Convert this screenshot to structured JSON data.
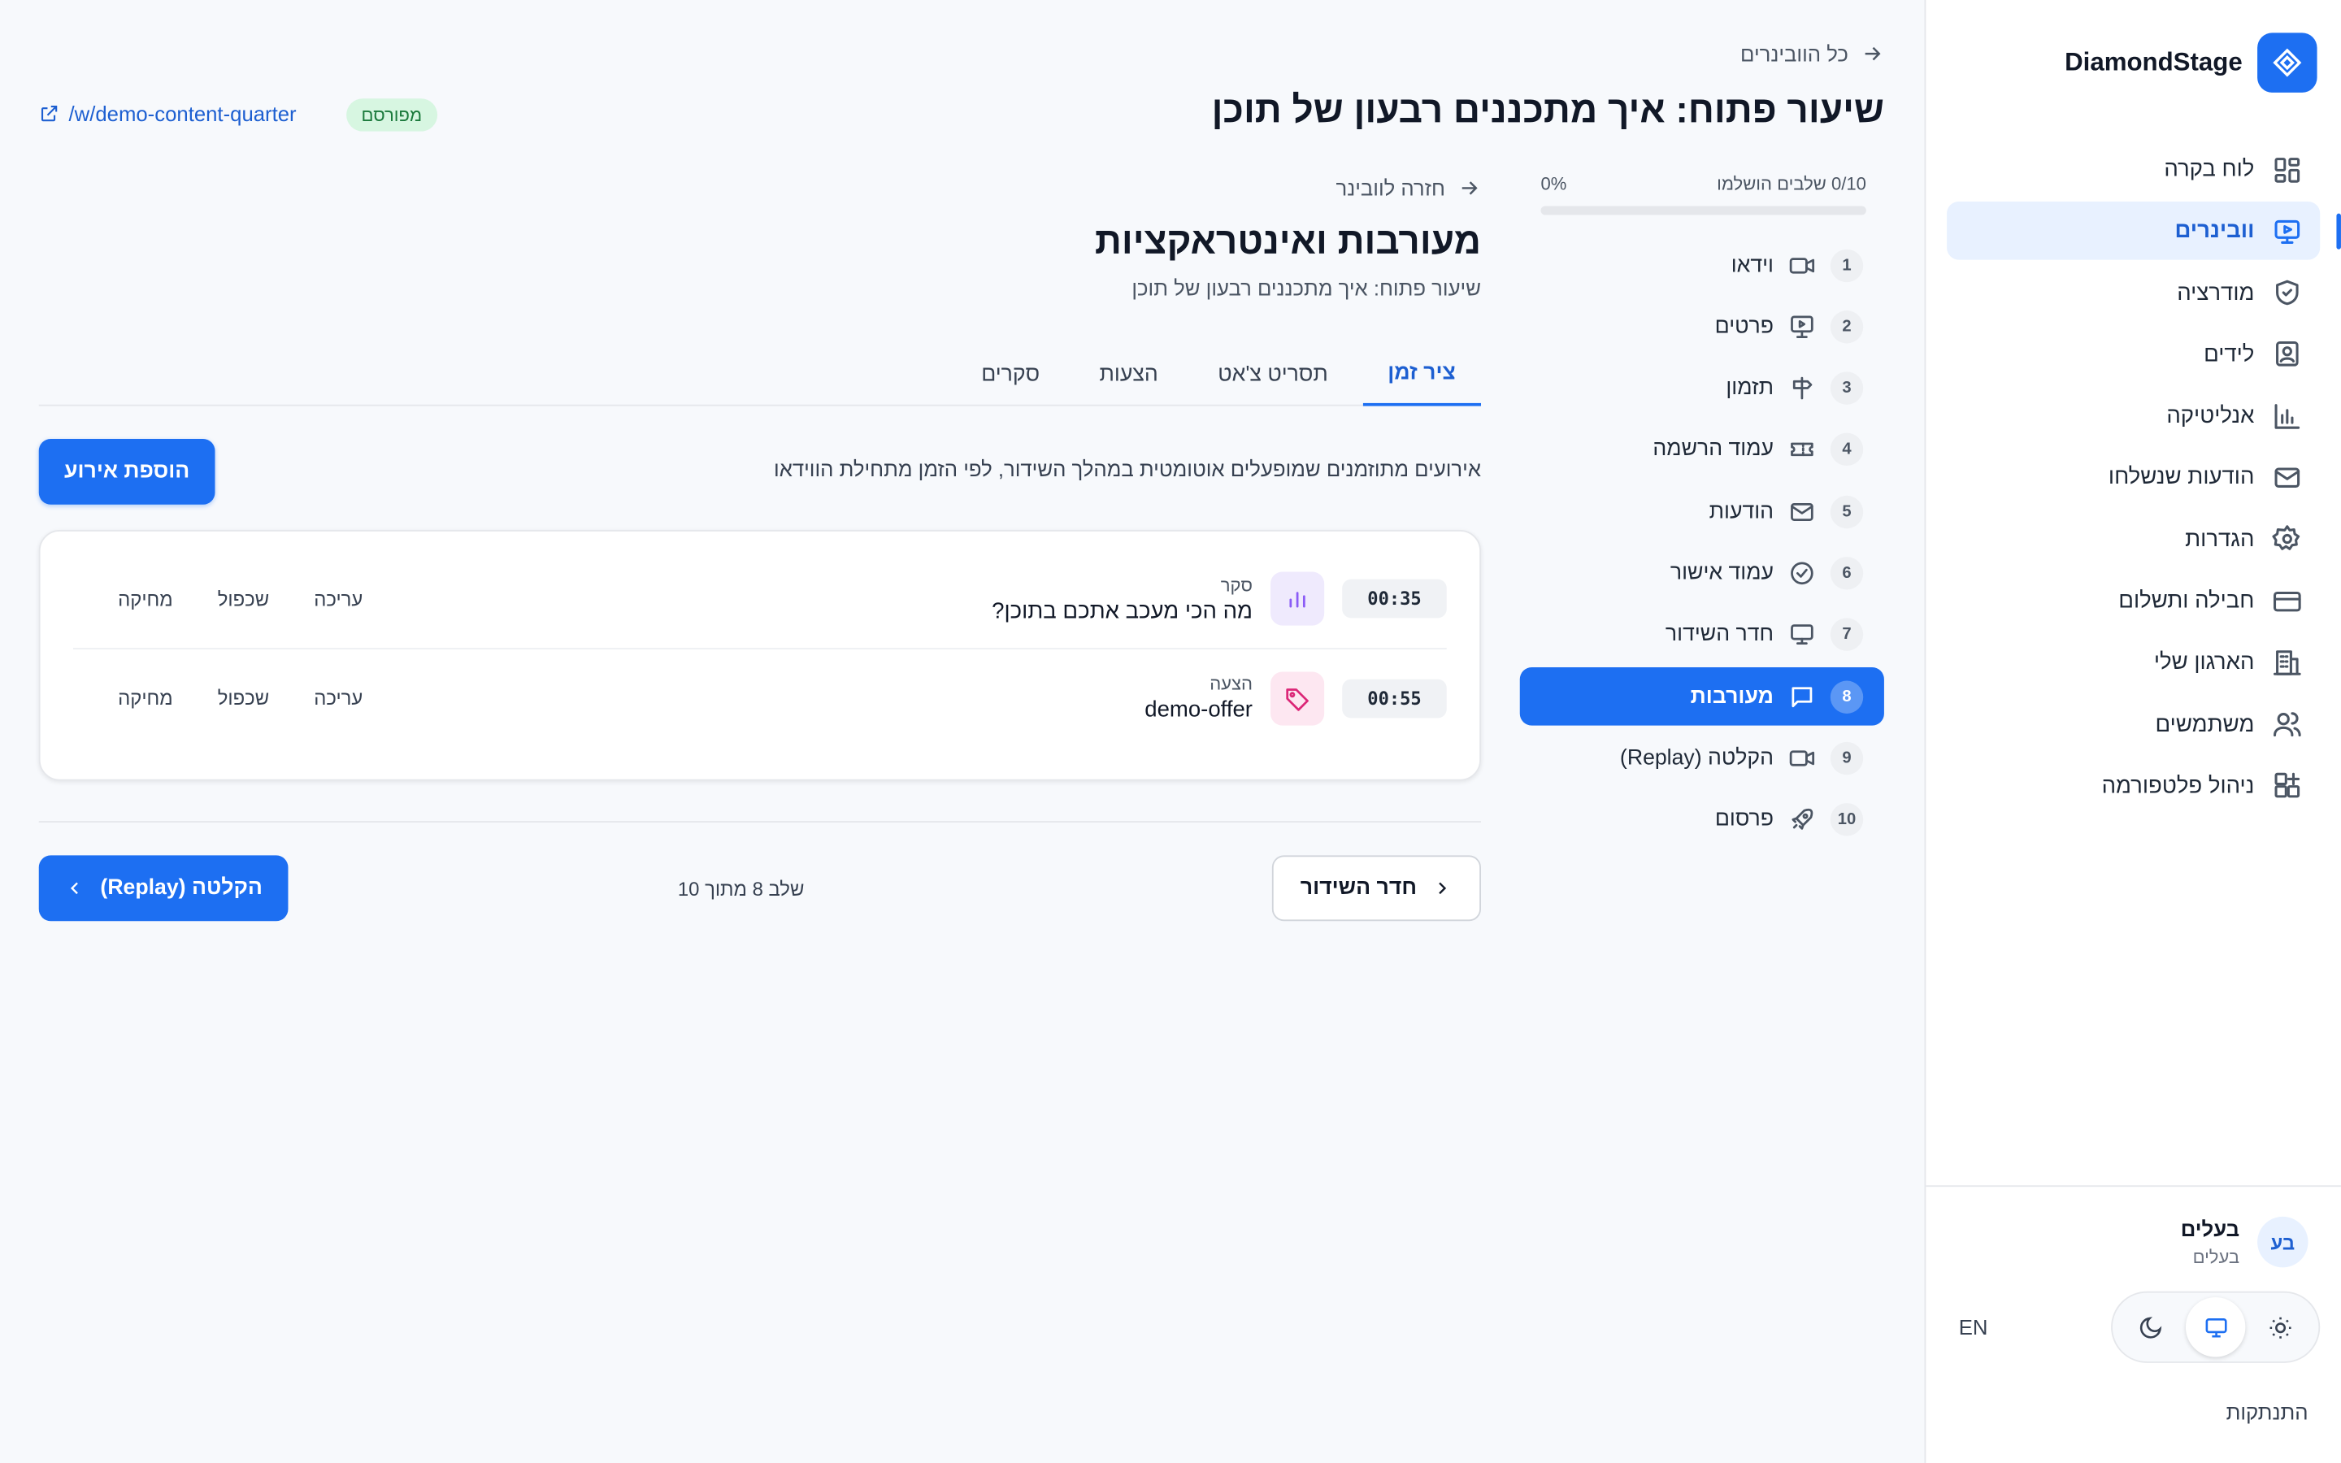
{
  "brand": {
    "name": "DiamondStage"
  },
  "sidebar": {
    "items": [
      {
        "label": "לוח בקרה",
        "icon": "dashboard-icon"
      },
      {
        "label": "וובינרים",
        "icon": "webinar-icon"
      },
      {
        "label": "מודרציה",
        "icon": "shield-icon"
      },
      {
        "label": "לידים",
        "icon": "contact-icon"
      },
      {
        "label": "אנליטיקה",
        "icon": "bar-chart-icon"
      },
      {
        "label": "הודעות שנשלחו",
        "icon": "mail-icon"
      },
      {
        "label": "הגדרות",
        "icon": "gear-icon"
      },
      {
        "label": "חבילה ותשלום",
        "icon": "credit-card-icon"
      },
      {
        "label": "הארגון שלי",
        "icon": "building-icon"
      },
      {
        "label": "משתמשים",
        "icon": "users-icon"
      },
      {
        "label": "ניהול פלטפורמה",
        "icon": "grid-plus-icon"
      }
    ],
    "active_index": 1,
    "user": {
      "initials": "בע",
      "name": "בעלים",
      "role": "בעלים"
    },
    "language": "EN",
    "logout": "התנתקות"
  },
  "header": {
    "back_label": "כל הוובינרים",
    "title": "שיעור פתוח: איך מתכננים רבעון של תוכן",
    "status_badge": "מפורסם",
    "url": "/w/demo-content-quarter"
  },
  "progress": {
    "label": "0/10 שלבים הושלמו",
    "percent_label": "0%",
    "fraction": 0
  },
  "steps": [
    {
      "num": "1",
      "label": "וידאו",
      "icon": "video-icon"
    },
    {
      "num": "2",
      "label": "פרטים",
      "icon": "presentation-icon"
    },
    {
      "num": "3",
      "label": "תזמון",
      "icon": "signpost-icon"
    },
    {
      "num": "4",
      "label": "עמוד הרשמה",
      "icon": "ticket-icon"
    },
    {
      "num": "5",
      "label": "הודעות",
      "icon": "mail-icon"
    },
    {
      "num": "6",
      "label": "עמוד אישור",
      "icon": "check-circle-icon"
    },
    {
      "num": "7",
      "label": "חדר השידור",
      "icon": "monitor-icon"
    },
    {
      "num": "8",
      "label": "מעורבות",
      "icon": "chat-icon"
    },
    {
      "num": "9",
      "label": "הקלטה (Replay)",
      "icon": "video-icon"
    },
    {
      "num": "10",
      "label": "פרסום",
      "icon": "rocket-icon"
    }
  ],
  "active_step": 7,
  "section": {
    "back_label": "חזרה לוובינר",
    "title": "מעורבות ואינטראקציות",
    "subtitle": "שיעור פתוח: איך מתכננים רבעון של תוכן",
    "tabs": [
      "ציר זמן",
      "תסריט צ'אט",
      "הצעות",
      "סקרים"
    ],
    "active_tab": 0,
    "description": "אירועים מתוזמנים שמופעלים אוטומטית במהלך השידור, לפי הזמן מתחילת הווידאו",
    "add_button": "הוספת אירוע"
  },
  "events": [
    {
      "time": "00:35",
      "type": "סקר",
      "title": "מה הכי מעכב אתכם בתוכן?",
      "icon": "poll-icon",
      "icon_color": "#8b5cf6",
      "icon_bg": "#efeafd"
    },
    {
      "time": "00:55",
      "type": "הצעה",
      "title": "demo-offer",
      "icon": "tag-icon",
      "icon_color": "#db2777",
      "icon_bg": "#fde7f1"
    }
  ],
  "event_actions": {
    "edit": "עריכה",
    "duplicate": "שכפול",
    "delete": "מחיקה"
  },
  "footer": {
    "prev_label": "חדר השידור",
    "step_text": "שלב 8 מתוך 10",
    "next_label": "הקלטה (Replay)"
  }
}
